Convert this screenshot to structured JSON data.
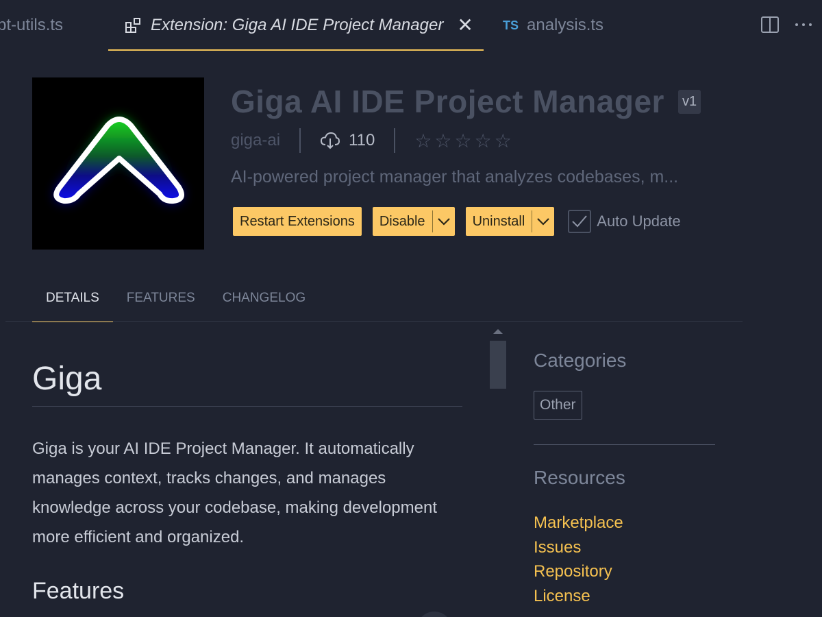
{
  "tabs": [
    {
      "label": "pt-utils.ts"
    },
    {
      "label": "Extension: Giga AI IDE Project Manager",
      "active": true,
      "icon": "extensions-icon"
    },
    {
      "label": "analysis.ts",
      "badge": "TS"
    }
  ],
  "extension": {
    "title": "Giga AI IDE Project Manager",
    "version": "v1",
    "publisher": "giga-ai",
    "installs": "110",
    "rating_stars": "☆☆☆☆☆",
    "description": "AI-powered project manager that analyzes codebases, m..."
  },
  "actions": {
    "restart": "Restart Extensions",
    "disable": "Disable",
    "uninstall": "Uninstall",
    "auto_update": "Auto Update"
  },
  "detail_tabs": [
    {
      "label": "DETAILS",
      "active": true
    },
    {
      "label": "FEATURES"
    },
    {
      "label": "CHANGELOG"
    }
  ],
  "readme": {
    "heading": "Giga",
    "paragraph": "Giga is your AI IDE Project Manager. It automatically manages context, tracks changes, and manages knowledge across your codebase, making development more efficient and organized.",
    "subheading": "Features"
  },
  "sidebar": {
    "categories_heading": "Categories",
    "category": "Other",
    "resources_heading": "Resources",
    "resources": [
      "Marketplace",
      "Issues",
      "Repository",
      "License"
    ]
  },
  "colors": {
    "accent": "#fcc865",
    "link": "#f5c150",
    "background": "#1f2330"
  }
}
